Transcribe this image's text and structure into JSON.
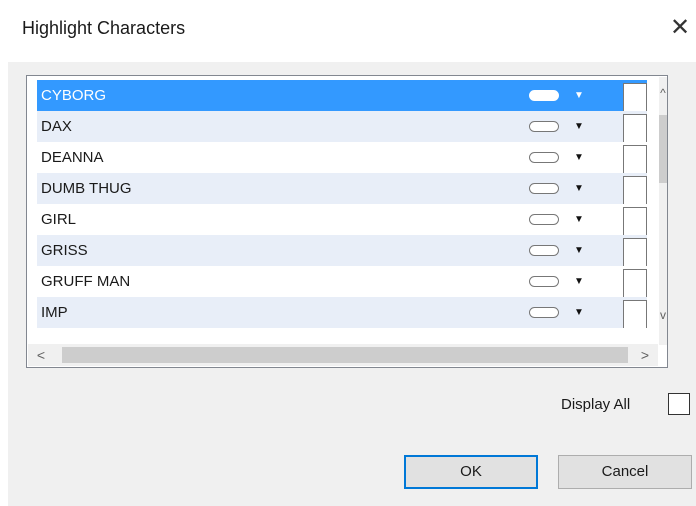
{
  "dialog": {
    "title": "Highlight Characters",
    "close_glyph": "✕"
  },
  "list": {
    "selected_index": 0,
    "selected_color": "#3399ff",
    "alt_row_color": "#e8eef8",
    "items": [
      {
        "name": "CYBORG"
      },
      {
        "name": "DAX"
      },
      {
        "name": "DEANNA"
      },
      {
        "name": "DUMB THUG"
      },
      {
        "name": "GIRL"
      },
      {
        "name": "GRISS"
      },
      {
        "name": "GRUFF MAN"
      },
      {
        "name": "IMP"
      }
    ],
    "dropdown_glyph": "▼",
    "scroll_up_glyph": "^",
    "scroll_down_glyph": "v",
    "scroll_left_glyph": "<",
    "scroll_right_glyph": ">"
  },
  "options": {
    "display_all_label": "Display All"
  },
  "buttons": {
    "ok_label": "OK",
    "cancel_label": "Cancel"
  }
}
